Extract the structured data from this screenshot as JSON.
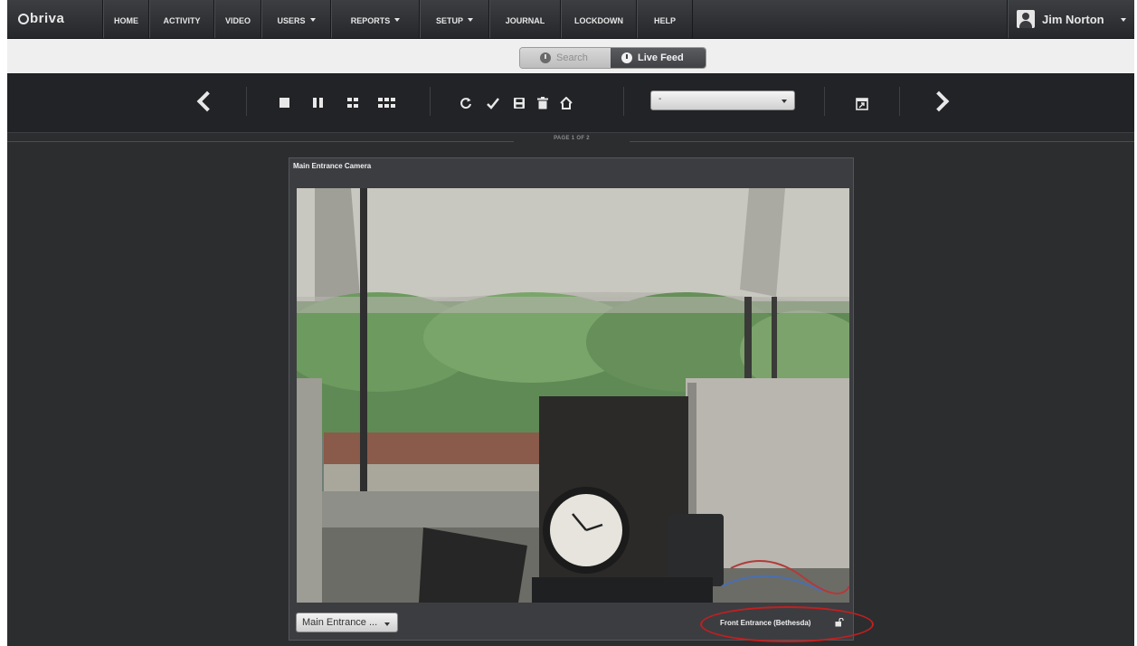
{
  "brand": {
    "logo": "briva"
  },
  "nav": {
    "items": [
      {
        "label": "HOME",
        "dropdown": false
      },
      {
        "label": "ACTIVITY",
        "dropdown": false
      },
      {
        "label": "VIDEO",
        "dropdown": false
      },
      {
        "label": "USERS",
        "dropdown": true
      },
      {
        "label": "REPORTS",
        "dropdown": true
      },
      {
        "label": "SETUP",
        "dropdown": true
      },
      {
        "label": "JOURNAL",
        "dropdown": false
      },
      {
        "label": "LOCKDOWN",
        "dropdown": false
      },
      {
        "label": "HELP",
        "dropdown": false
      }
    ],
    "user": {
      "name": "Jim Norton",
      "icon": "user-avatar-icon"
    }
  },
  "modes": {
    "search_label": "Search",
    "live_label": "Live Feed",
    "active": "Live Feed"
  },
  "toolbar": {
    "icons": [
      "chevron-left-icon",
      "layout-1x1-icon",
      "layout-2-icon",
      "layout-2x2-icon",
      "layout-3x2-icon",
      "refresh-icon",
      "checkmark-icon",
      "save-icon",
      "trash-icon",
      "home-icon",
      "popout-icon",
      "chevron-right-icon"
    ],
    "layout_select_value": "-",
    "page_label": "PAGE 1 OF 2"
  },
  "camera": {
    "title": "Main Entrance Camera",
    "camera_select_value": "Main Entrance ...",
    "door_label": "Front Entrance (Bethesda)",
    "door_icon": "unlock-icon"
  },
  "colors": {
    "highlight": "#c41f1f",
    "nav_bg": "#2e3034",
    "page_bg": "#2c2d2f"
  }
}
